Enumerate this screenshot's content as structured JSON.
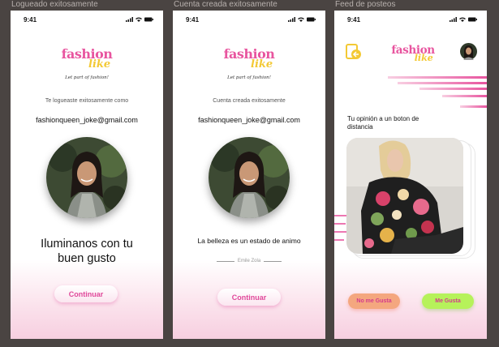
{
  "frames": [
    {
      "title": "Logueado exitosamente",
      "status_time": "9:41",
      "logo": {
        "word1": "fashion",
        "word2": "like",
        "slogan": "Let part of fashion!"
      },
      "caption": "Te logueaste exitosamente como",
      "email": "fashionqueen_joke@gmail.com",
      "headline": "Iluminanos con tu buen gusto",
      "button": "Continuar"
    },
    {
      "title": "Cuenta creada exitosamente",
      "status_time": "9:41",
      "logo": {
        "word1": "fashion",
        "word2": "like",
        "slogan": "Let part of fashion!"
      },
      "caption": "Cuenta creada exitosamente",
      "email": "fashionqueen_joke@gmail.com",
      "quote": "La belleza es un estado de animo",
      "author": "Emile Zola",
      "button": "Continuar"
    },
    {
      "title": "Feed de posteos",
      "status_time": "9:41",
      "logo": {
        "word1": "fashion",
        "word2": "like"
      },
      "prompt": "Tu opinión a un boton de distancia",
      "dislike": "No me Gusta",
      "like": "Me Gusta"
    }
  ],
  "colors": {
    "brand_pink": "#e8559f",
    "brand_yellow": "#f3c934",
    "dislike_bg": "#f4a77f",
    "like_bg": "#b6f25a"
  },
  "icons": [
    "signal-icon",
    "wifi-icon",
    "battery-icon",
    "logout-icon",
    "avatar"
  ]
}
